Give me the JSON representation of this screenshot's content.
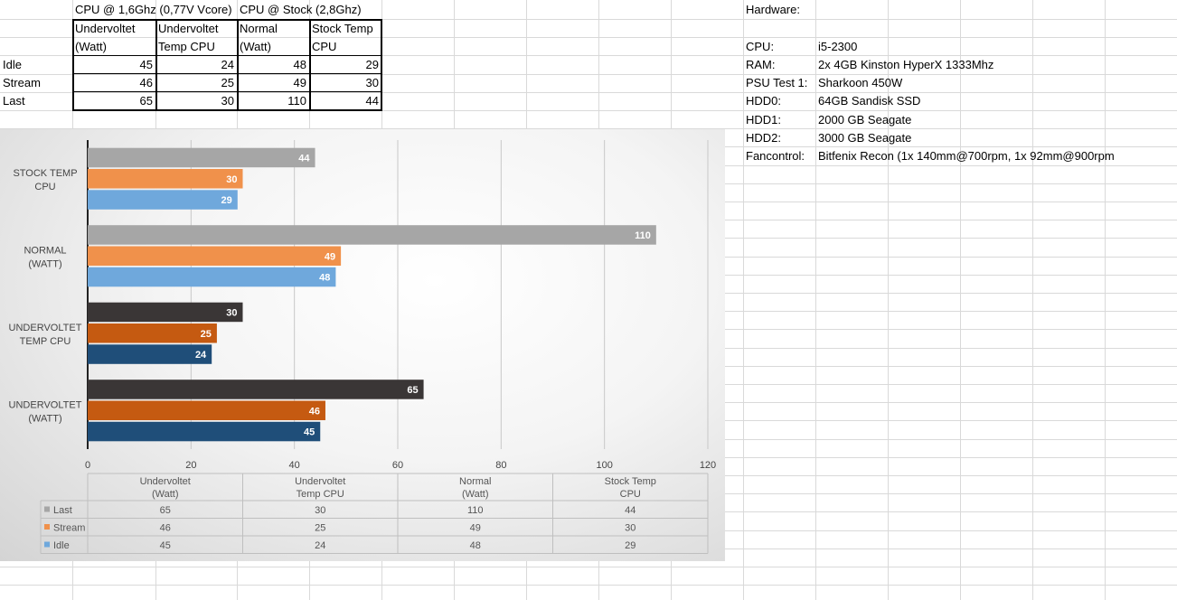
{
  "sheet": {
    "header_groups": [
      "CPU @ 1,6Ghz (0,77V Vcore)",
      "CPU @ Stock (2,8Ghz)"
    ],
    "col_headers": [
      [
        "Undervoltet",
        "(Watt)"
      ],
      [
        "Undervoltet",
        "Temp CPU"
      ],
      [
        "Normal",
        "(Watt)"
      ],
      [
        "Stock Temp",
        "CPU"
      ]
    ],
    "rows": [
      {
        "label": "Idle",
        "values": [
          "45",
          "24",
          "48",
          "29"
        ]
      },
      {
        "label": "Stream",
        "values": [
          "46",
          "25",
          "49",
          "30"
        ]
      },
      {
        "label": "Last",
        "values": [
          "65",
          "30",
          "110",
          "44"
        ]
      }
    ]
  },
  "hardware": {
    "title": "Hardware:",
    "items": [
      {
        "key": "CPU:",
        "value": "i5-2300"
      },
      {
        "key": "RAM:",
        "value": "2x 4GB Kinston HyperX 1333Mhz"
      },
      {
        "key": "PSU Test 1:",
        "value": "Sharkoon 450W"
      },
      {
        "key": "HDD0:",
        "value": "64GB Sandisk SSD"
      },
      {
        "key": "HDD1:",
        "value": "2000 GB Seagate"
      },
      {
        "key": "HDD2:",
        "value": "3000 GB Seagate"
      },
      {
        "key": "Fancontrol:",
        "value": "Bitfenix Recon (1x 140mm@700rpm, 1x 92mm@900rpm"
      }
    ]
  },
  "chart_data": {
    "type": "bar",
    "orientation": "horizontal",
    "categories": [
      "Undervoltet (Watt)",
      "Undervoltet Temp CPU",
      "Normal (Watt)",
      "Stock Temp CPU"
    ],
    "category_axis_labels": [
      [
        "UNDERVOLTET",
        "(WATT)"
      ],
      [
        "UNDERVOLTET",
        "TEMP CPU"
      ],
      [
        "NORMAL",
        "(WATT)"
      ],
      [
        "STOCK TEMP",
        "CPU"
      ]
    ],
    "table_headers": [
      [
        "Undervoltet",
        "(Watt)"
      ],
      [
        "Undervoltet",
        "Temp CPU"
      ],
      [
        "Normal",
        "(Watt)"
      ],
      [
        "Stock Temp",
        "CPU"
      ]
    ],
    "series": [
      {
        "name": "Last",
        "values": [
          65,
          30,
          110,
          44
        ]
      },
      {
        "name": "Stream",
        "values": [
          46,
          25,
          49,
          30
        ]
      },
      {
        "name": "Idle",
        "values": [
          45,
          24,
          48,
          29
        ]
      }
    ],
    "colors_by_category": [
      [
        "#3a3636",
        "#c55a11",
        "#1f4e79"
      ],
      [
        "#3a3636",
        "#c55a11",
        "#1f4e79"
      ],
      [
        "#a6a6a6",
        "#f0914b",
        "#6fa8dc"
      ],
      [
        "#a6a6a6",
        "#f0914b",
        "#6fa8dc"
      ]
    ],
    "legend_colors": [
      "#a6a6a6",
      "#f0914b",
      "#6fa8dc"
    ],
    "xlim": [
      0,
      120
    ],
    "xticks": [
      0,
      20,
      40,
      60,
      80,
      100,
      120
    ],
    "grid": true,
    "data_table": true
  }
}
